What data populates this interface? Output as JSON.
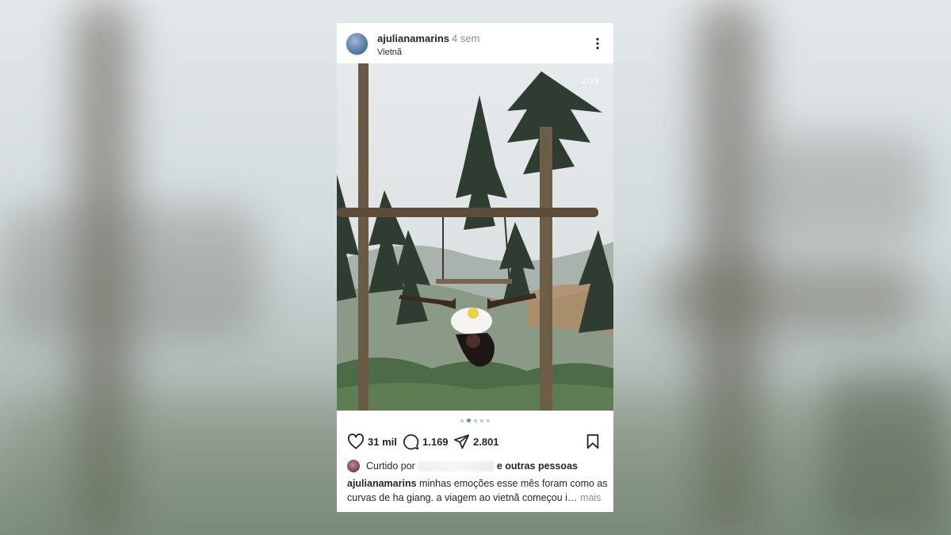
{
  "post": {
    "username": "ajulianamarins",
    "time_ago": "4 sem",
    "location": "Vietnã",
    "carousel_counter": "2/19",
    "carousel_dots": 5,
    "carousel_active_index": 1,
    "likes": "31 mil",
    "comments": "1.169",
    "shares": "2.801",
    "liked_by_prefix": "Curtido por",
    "liked_by_suffix": "e outras pessoas",
    "caption_user": "ajulianamarins",
    "caption_text": "minhas emoções esse mês foram como as curvas de ha giang. a viagem ao vietnã começou i…",
    "caption_more": "mais"
  },
  "icons": {
    "more": "more-options-icon",
    "like": "heart-icon",
    "comment": "comment-icon",
    "share": "send-icon",
    "save": "bookmark-icon"
  },
  "colors": {
    "text": "#262626",
    "muted": "#8e8e8e",
    "active_dot": "#3897f0"
  }
}
